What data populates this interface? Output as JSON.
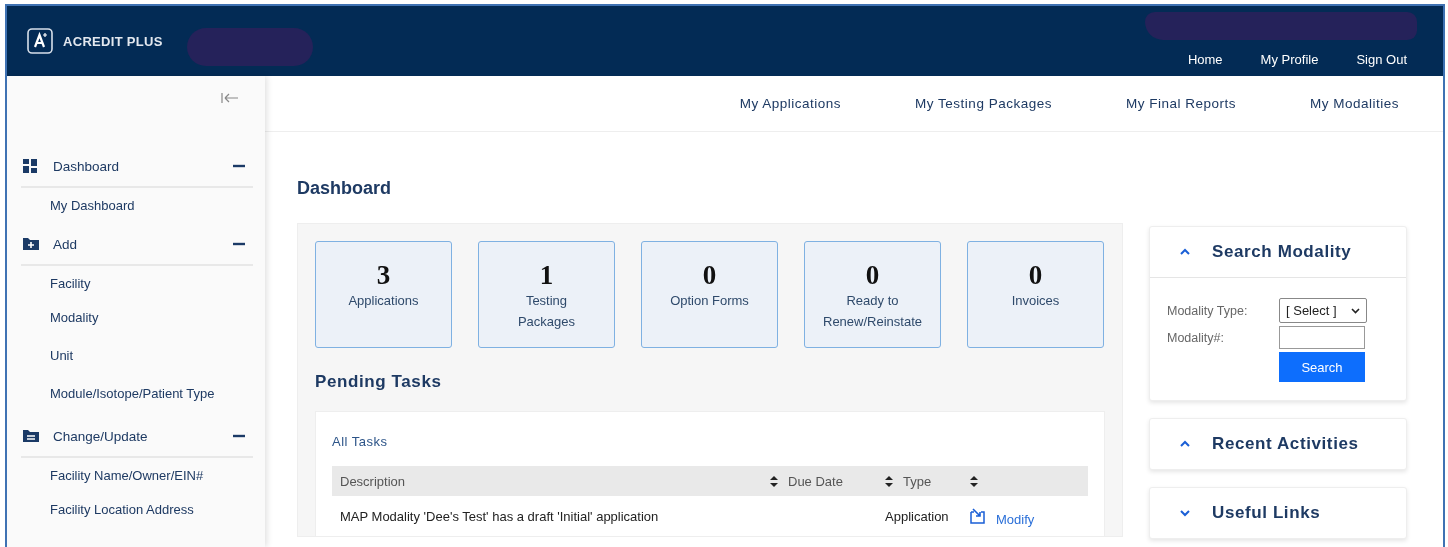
{
  "header": {
    "logo_text": "ACREDIT PLUS",
    "nav_links": [
      "Home",
      "My Profile",
      "Sign Out"
    ]
  },
  "sidebar": {
    "sections": [
      {
        "kind": "dashboard",
        "label": "Dashboard",
        "expanded": true,
        "items": [
          "My Dashboard"
        ]
      },
      {
        "kind": "add",
        "label": "Add",
        "expanded": true,
        "items": [
          "Facility",
          "Modality",
          "Unit",
          "Module/Isotope/Patient Type"
        ]
      },
      {
        "kind": "change",
        "label": "Change/Update",
        "expanded": true,
        "items": [
          "Facility Name/Owner/EIN#",
          "Facility Location Address"
        ]
      }
    ]
  },
  "top_nav": [
    "My Applications",
    "My Testing Packages",
    "My Final Reports",
    "My Modalities"
  ],
  "page_title": "Dashboard",
  "stats": [
    {
      "value": "3",
      "label": "Applications"
    },
    {
      "value": "1",
      "label": "Testing Packages"
    },
    {
      "value": "0",
      "label": "Option Forms"
    },
    {
      "value": "0",
      "label": "Ready to Renew/Reinstate"
    },
    {
      "value": "0",
      "label": "Invoices"
    }
  ],
  "pending_tasks": {
    "title": "Pending Tasks",
    "tab": "All Tasks",
    "columns": [
      "Description",
      "Due Date",
      "Type"
    ],
    "rows": [
      {
        "description": "MAP Modality 'Dee's Test' has a draft 'Initial' application",
        "type": "Application",
        "action": "Modify"
      }
    ]
  },
  "side_panels": [
    {
      "kind": "search",
      "title": "Search Modality",
      "expanded": true,
      "type_label": "Modality Type:",
      "select_value": "[ Select ]",
      "number_label": "Modality#:",
      "button": "Search"
    },
    {
      "kind": "plain",
      "title": "Recent Activities",
      "expanded": true
    },
    {
      "kind": "plain",
      "title": "Useful Links",
      "expanded": false
    }
  ]
}
